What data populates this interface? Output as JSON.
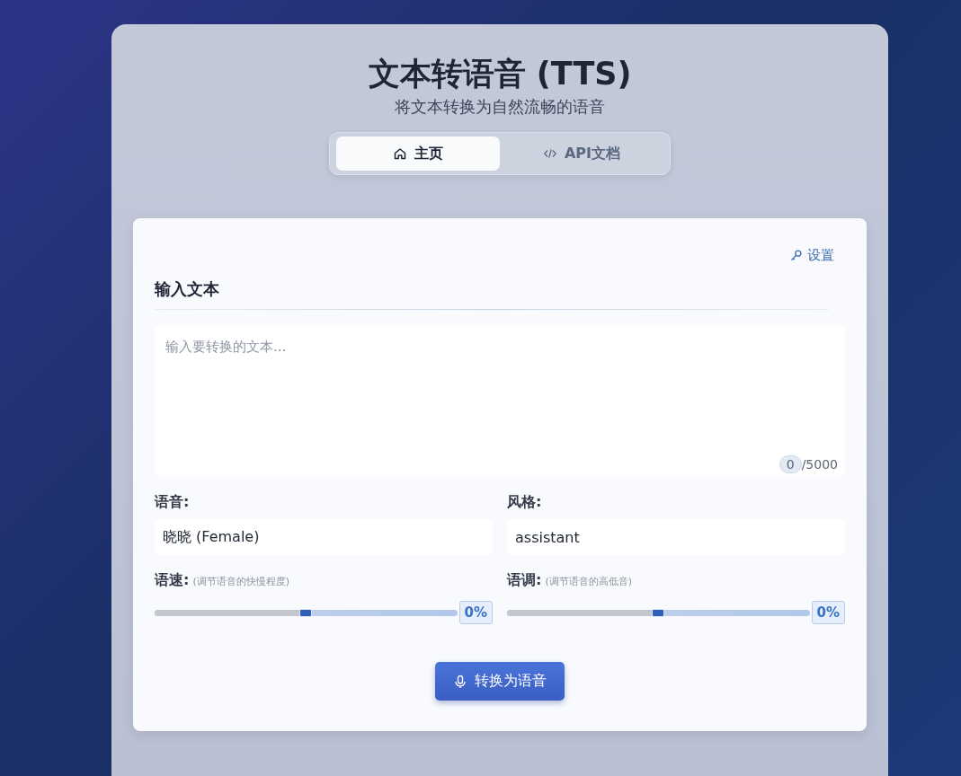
{
  "header": {
    "title": "文本转语音 (TTS)",
    "subtitle": "将文本转换为自然流畅的语音"
  },
  "tabs": [
    {
      "label": "主页",
      "kind": "home",
      "selected": true
    },
    {
      "label": "API文档",
      "kind": "code",
      "selected": false
    }
  ],
  "settings_link": "设置",
  "section_title": "输入文本",
  "text_input": {
    "placeholder": "输入要转换的文本...",
    "count": "0",
    "limit": "/5000"
  },
  "selects": [
    {
      "label": "语音:",
      "value": "晓晓 (Female)"
    },
    {
      "label": "风格:",
      "value": "assistant"
    }
  ],
  "sliders": [
    {
      "label": "语速:",
      "hint": "(调节语音的快慢程度)",
      "level": 0.5,
      "reading": "0%"
    },
    {
      "label": "语调:",
      "hint": "(调节语音的高低音)",
      "level": 0.5,
      "reading": "0%"
    }
  ],
  "convert_button": "转换为语音"
}
